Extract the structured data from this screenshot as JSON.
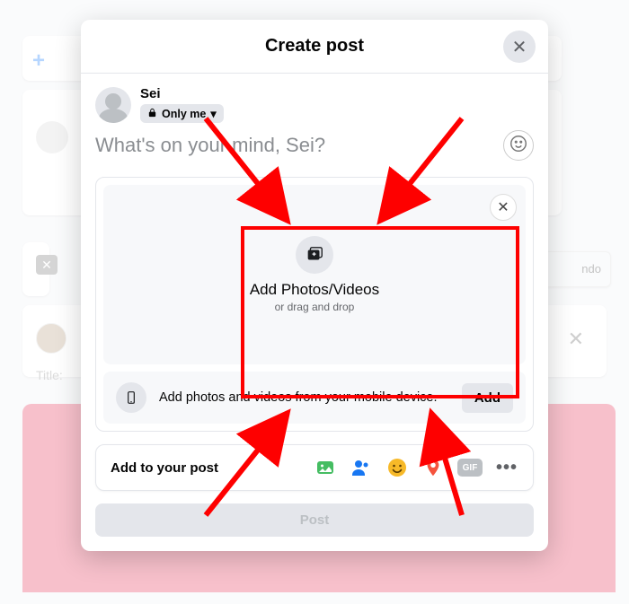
{
  "modal": {
    "title": "Create post",
    "user_name": "Sei",
    "audience_label": "Only me",
    "composer_placeholder": "What's on your mind, Sei?",
    "dropzone": {
      "title": "Add Photos/Videos",
      "sub": "or drag and drop"
    },
    "mobile_row_text": "Add photos and videos from your mobile device.",
    "add_button": "Add",
    "enhance_label": "Add to your post",
    "gif_label": "GIF",
    "post_button": "Post"
  },
  "background": {
    "title_hint": "Title:",
    "right_button_hint": "ndo"
  }
}
